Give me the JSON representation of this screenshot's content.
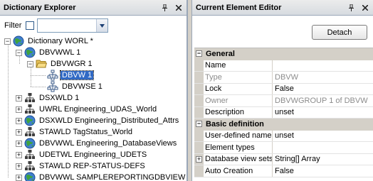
{
  "left_panel": {
    "title": "Dictionary Explorer",
    "filter_label": "Filter",
    "filter_checked": false,
    "filter_value": "",
    "tree": [
      {
        "label": "Dictionary WORL *",
        "icon": "globe-icon",
        "level": 0,
        "expander": "-"
      },
      {
        "label": "DBVWWL 1",
        "icon": "globe-icon",
        "level": 1,
        "expander": "-"
      },
      {
        "label": "DBVWGR 1",
        "icon": "folder-open-icon",
        "level": 2,
        "expander": "-"
      },
      {
        "label": "DBVW 1",
        "icon": "db-view-icon",
        "level": 3,
        "expander": "",
        "selected": true
      },
      {
        "label": "DBVWSE 1",
        "icon": "db-view-icon",
        "level": 3,
        "expander": ""
      },
      {
        "label": "DSXWLD 1",
        "icon": "hierarchy-icon",
        "level": 1,
        "expander": "+"
      },
      {
        "label": "UWRL Engineering_UDAS_World",
        "icon": "hierarchy-icon",
        "level": 1,
        "expander": "+"
      },
      {
        "label": "DSXWLD Engineering_Distributed_Attrs",
        "icon": "globe-icon",
        "level": 1,
        "expander": "+"
      },
      {
        "label": "STAWLD TagStatus_World",
        "icon": "hierarchy-icon",
        "level": 1,
        "expander": "+"
      },
      {
        "label": "DBVWWL Engineering_DatabaseViews",
        "icon": "globe-icon",
        "level": 1,
        "expander": "+"
      },
      {
        "label": "UDETWL Engineering_UDETS",
        "icon": "hierarchy-icon",
        "level": 1,
        "expander": "+"
      },
      {
        "label": "STAWLD REP-STATUS-DEFS",
        "icon": "hierarchy-icon",
        "level": 1,
        "expander": "+"
      },
      {
        "label": "DBVWWL SAMPLEREPORTINGDBVIEW",
        "icon": "globe-icon",
        "level": 1,
        "expander": "+"
      }
    ]
  },
  "right_panel": {
    "title": "Current Element Editor",
    "detach_label": "Detach",
    "categories": [
      {
        "name": "General",
        "rows": [
          {
            "name": "Name",
            "value": "",
            "disabled": false
          },
          {
            "name": "Type",
            "value": "DBVW",
            "disabled": true
          },
          {
            "name": "Lock",
            "value": "False",
            "disabled": false
          },
          {
            "name": "Owner",
            "value": "DBVWGROUP 1 of DBVW",
            "disabled": true
          },
          {
            "name": "Description",
            "value": "unset",
            "disabled": false
          }
        ]
      },
      {
        "name": "Basic definition",
        "rows": [
          {
            "name": "User-defined name",
            "value": "unset",
            "disabled": false
          },
          {
            "name": "Element types",
            "value": "",
            "disabled": false
          },
          {
            "name": "Database view sets",
            "value": "String[] Array",
            "disabled": false,
            "expander": "+"
          },
          {
            "name": "Auto Creation",
            "value": "False",
            "disabled": false
          }
        ]
      }
    ]
  },
  "colors": {
    "selection": "#316ac5",
    "header_bg": "#d7dbe0",
    "category_bg": "#d4d0c8",
    "disabled_text": "#8c8c8c"
  }
}
